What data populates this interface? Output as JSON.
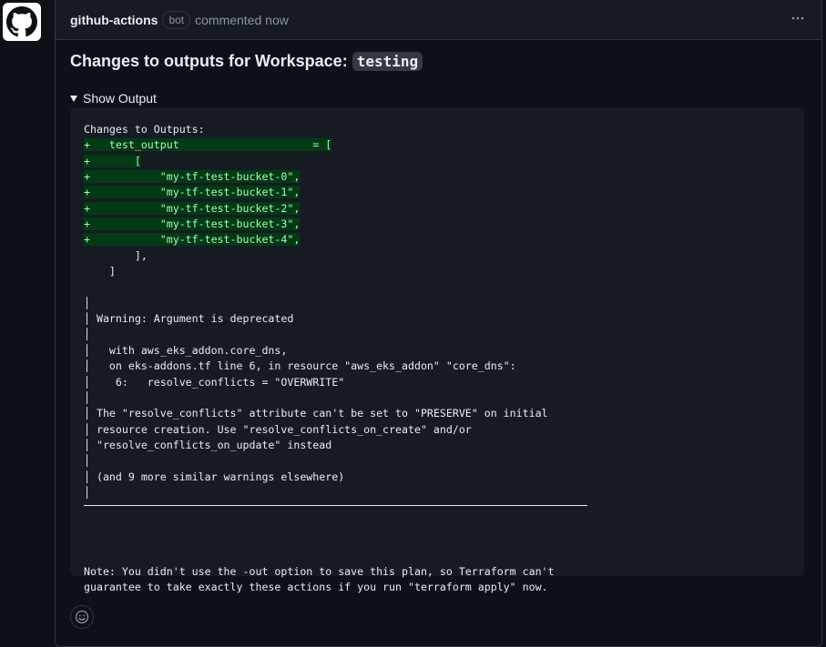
{
  "comment": {
    "author": "github-actions",
    "badge": "bot",
    "time": "commented now",
    "menu_icon": "kebab-horizontal-icon",
    "avatar_icon": "github-mark-icon"
  },
  "body": {
    "title_prefix": "Changes to outputs for Workspace:",
    "workspace": "testing",
    "details_summary": "Show Output"
  },
  "output": {
    "lines": [
      {
        "text": "Changes to Outputs:",
        "added": false
      },
      {
        "text": "+   test_output                     = [",
        "added": true
      },
      {
        "text": "+       [",
        "added": true
      },
      {
        "text": "+           \"my-tf-test-bucket-0\",",
        "added": true
      },
      {
        "text": "+           \"my-tf-test-bucket-1\",",
        "added": true
      },
      {
        "text": "+           \"my-tf-test-bucket-2\",",
        "added": true
      },
      {
        "text": "+           \"my-tf-test-bucket-3\",",
        "added": true
      },
      {
        "text": "+           \"my-tf-test-bucket-4\",",
        "added": true
      },
      {
        "text": "        ],",
        "added": false
      },
      {
        "text": "    ]",
        "added": false
      },
      {
        "text": "",
        "added": false
      },
      {
        "text": "│",
        "added": false
      },
      {
        "text": "│ Warning: Argument is deprecated",
        "added": false
      },
      {
        "text": "│",
        "added": false
      },
      {
        "text": "│   with aws_eks_addon.core_dns,",
        "added": false
      },
      {
        "text": "│   on eks-addons.tf line 6, in resource \"aws_eks_addon\" \"core_dns\":",
        "added": false
      },
      {
        "text": "│    6:   resolve_conflicts = \"OVERWRITE\"",
        "added": false
      },
      {
        "text": "│",
        "added": false
      },
      {
        "text": "│ The \"resolve_conflicts\" attribute can't be set to \"PRESERVE\" on initial",
        "added": false
      },
      {
        "text": "│ resource creation. Use \"resolve_conflicts_on_create\" and/or",
        "added": false
      },
      {
        "text": "│ \"resolve_conflicts_on_update\" instead",
        "added": false
      },
      {
        "text": "│",
        "added": false
      },
      {
        "text": "│ (and 9 more similar warnings elsewhere)",
        "added": false
      },
      {
        "text": "│",
        "added": false
      },
      {
        "text": "",
        "added": false
      },
      {
        "text": "",
        "added": false
      },
      {
        "text": "",
        "added": false
      },
      {
        "text": "",
        "added": false
      },
      {
        "text": "Note: You didn't use the -out option to save this plan, so Terraform can't",
        "added": false
      },
      {
        "text": "guarantee to take exactly these actions if you run \"terraform apply\" now.",
        "added": false
      }
    ]
  },
  "footer": {
    "reaction_icon": "smiley-icon"
  }
}
